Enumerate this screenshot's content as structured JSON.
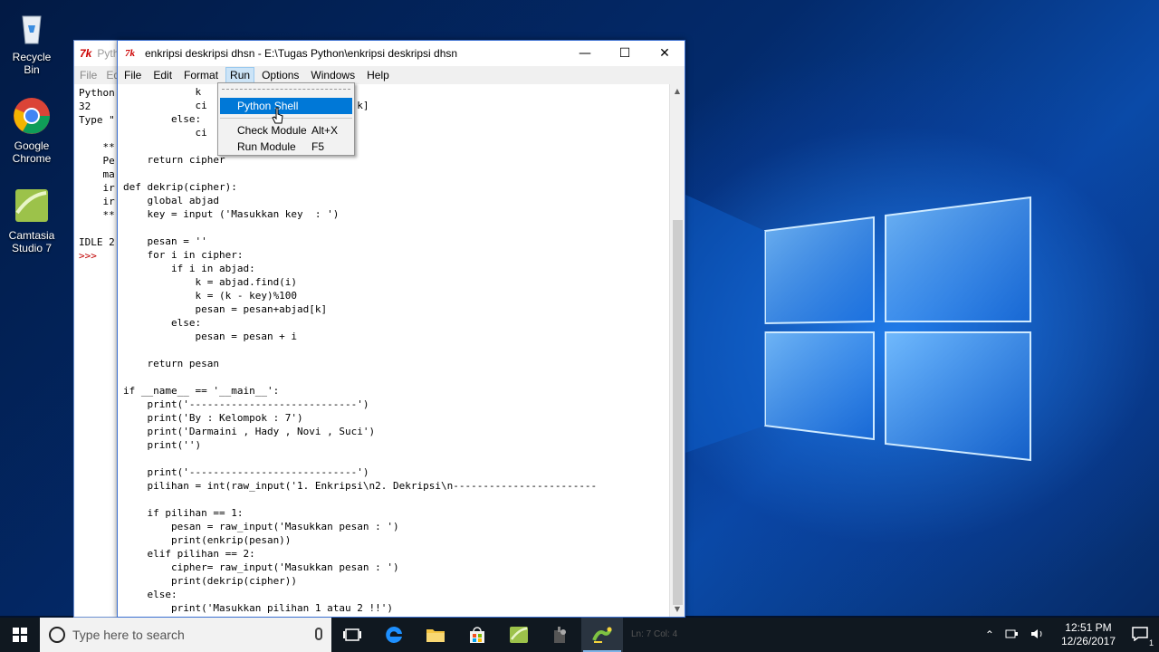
{
  "desktop": {
    "icons": [
      {
        "label": "Recycle Bin"
      },
      {
        "label": "Google Chrome"
      },
      {
        "label": "Camtasia Studio 7"
      }
    ]
  },
  "shell_window": {
    "title": "Pyth",
    "menu": [
      "File",
      "Ed"
    ],
    "lines": [
      "Python",
      "32",
      "Type \"",
      "",
      "    **",
      "    Pe",
      "    ma",
      "    ir",
      "    ir",
      "    **",
      "",
      "IDLE 2"
    ],
    "prompt": ">>>"
  },
  "editor": {
    "title": "enkripsi deskripsi dhsn - E:\\Tugas Python\\enkripsi deskripsi dhsn",
    "menu": [
      "File",
      "Edit",
      "Format",
      "Run",
      "Options",
      "Windows",
      "Help"
    ],
    "active_menu": "Run",
    "code_lines": [
      "            k",
      "            ci                         k]",
      "        else:",
      "            ci",
      "",
      "    return cipher",
      "",
      "def dekrip(cipher):",
      "    global abjad",
      "    key = input ('Masukkan key  : ')",
      "",
      "    pesan = ''",
      "    for i in cipher:",
      "        if i in abjad:",
      "            k = abjad.find(i)",
      "            k = (k - key)%100",
      "            pesan = pesan+abjad[k]",
      "        else:",
      "            pesan = pesan + i",
      "",
      "    return pesan",
      "",
      "if __name__ == '__main__':",
      "    print('----------------------------')",
      "    print('By : Kelompok : 7')",
      "    print('Darmaini , Hady , Novi , Suci')",
      "    print('')",
      "",
      "    print('----------------------------')",
      "    pilihan = int(raw_input('1. Enkripsi\\n2. Dekripsi\\n------------------------",
      "",
      "    if pilihan == 1:",
      "        pesan = raw_input('Masukkan pesan : ')",
      "        print(enkrip(pesan))",
      "    elif pilihan == 2:",
      "        cipher= raw_input('Masukkan pesan : ')",
      "        print(dekrip(cipher))",
      "    else:",
      "        print('Masukkan pilihan 1 atau 2 !!')"
    ]
  },
  "run_menu": {
    "items": [
      {
        "label": "Python Shell",
        "accel": "",
        "selected": true
      },
      {
        "label": "Check Module",
        "accel": "Alt+X",
        "selected": false
      },
      {
        "label": "Run Module",
        "accel": "F5",
        "selected": false
      }
    ]
  },
  "taskbar": {
    "search_placeholder": "Type here to search",
    "status_text": "Ln: 7 Col: 4",
    "time": "12:51 PM",
    "date": "12/26/2017",
    "notification_count": "1"
  },
  "colors": {
    "accent": "#0078d7",
    "taskbar": "#101820",
    "prompt": "#c00000"
  }
}
